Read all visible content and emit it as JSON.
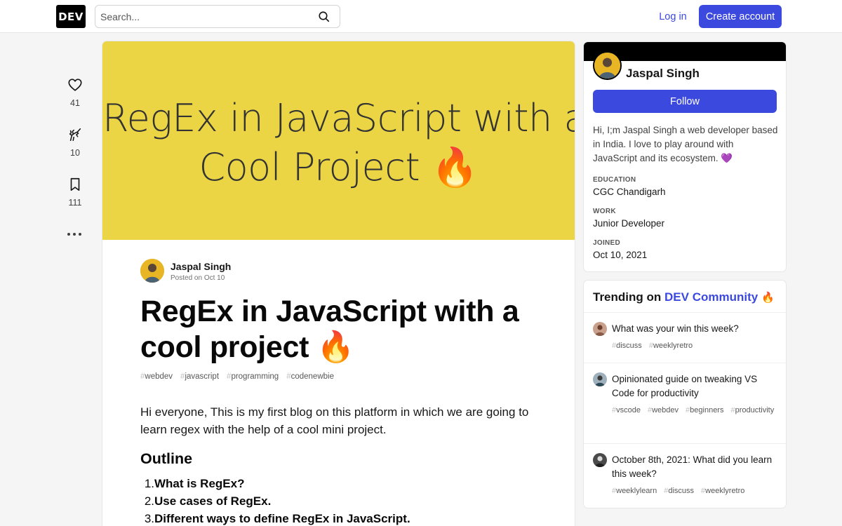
{
  "header": {
    "logo": "DEV",
    "search_placeholder": "Search...",
    "login_label": "Log in",
    "create_account_label": "Create account",
    "accent_color": "#3b49df"
  },
  "reactions": [
    {
      "icon": "heart-icon",
      "count": "41"
    },
    {
      "icon": "unicorn-icon",
      "count": "10"
    },
    {
      "icon": "bookmark-icon",
      "count": "111"
    }
  ],
  "article": {
    "cover": {
      "background": "#ebd545",
      "line1": "RegEx in JavaScript with a",
      "line2": "Cool Project 🔥"
    },
    "author": "Jaspal Singh",
    "posted": "Posted on Oct 10",
    "title": "RegEx in JavaScript with a cool project 🔥",
    "tags": [
      "webdev",
      "javascript",
      "programming",
      "codenewbie"
    ],
    "intro": "Hi everyone, This is my first blog on this platform in which we are going to learn regex with the help of a cool mini project.",
    "outline_heading": "Outline",
    "outline": [
      {
        "num": "1.",
        "text": "What is RegEx?"
      },
      {
        "num": "2.",
        "text": "Use cases of RegEx."
      },
      {
        "num": "3.",
        "text": "Different ways to define RegEx in JavaScript."
      }
    ]
  },
  "profile": {
    "name": "Jaspal Singh",
    "follow_label": "Follow",
    "bio": "Hi, I;m Jaspal Singh a web developer based in India. I love to play around with JavaScript and its ecosystem. 💜",
    "education_label": "EDUCATION",
    "education": "CGC Chandigarh",
    "work_label": "WORK",
    "work": "Junior Developer",
    "joined_label": "JOINED",
    "joined": "Oct 10, 2021"
  },
  "trending": {
    "heading_prefix": "Trending on",
    "heading_accent": "DEV Community",
    "heading_emoji": "🔥",
    "items": [
      {
        "title": "What was your win this week?",
        "tags": [
          "discuss",
          "weeklyretro"
        ]
      },
      {
        "title": "Opinionated guide on tweaking VS Code for productivity",
        "tags": [
          "vscode",
          "webdev",
          "beginners",
          "productivity"
        ]
      },
      {
        "title": "October 8th, 2021: What did you learn this week?",
        "tags": [
          "weeklylearn",
          "discuss",
          "weeklyretro"
        ]
      }
    ]
  }
}
